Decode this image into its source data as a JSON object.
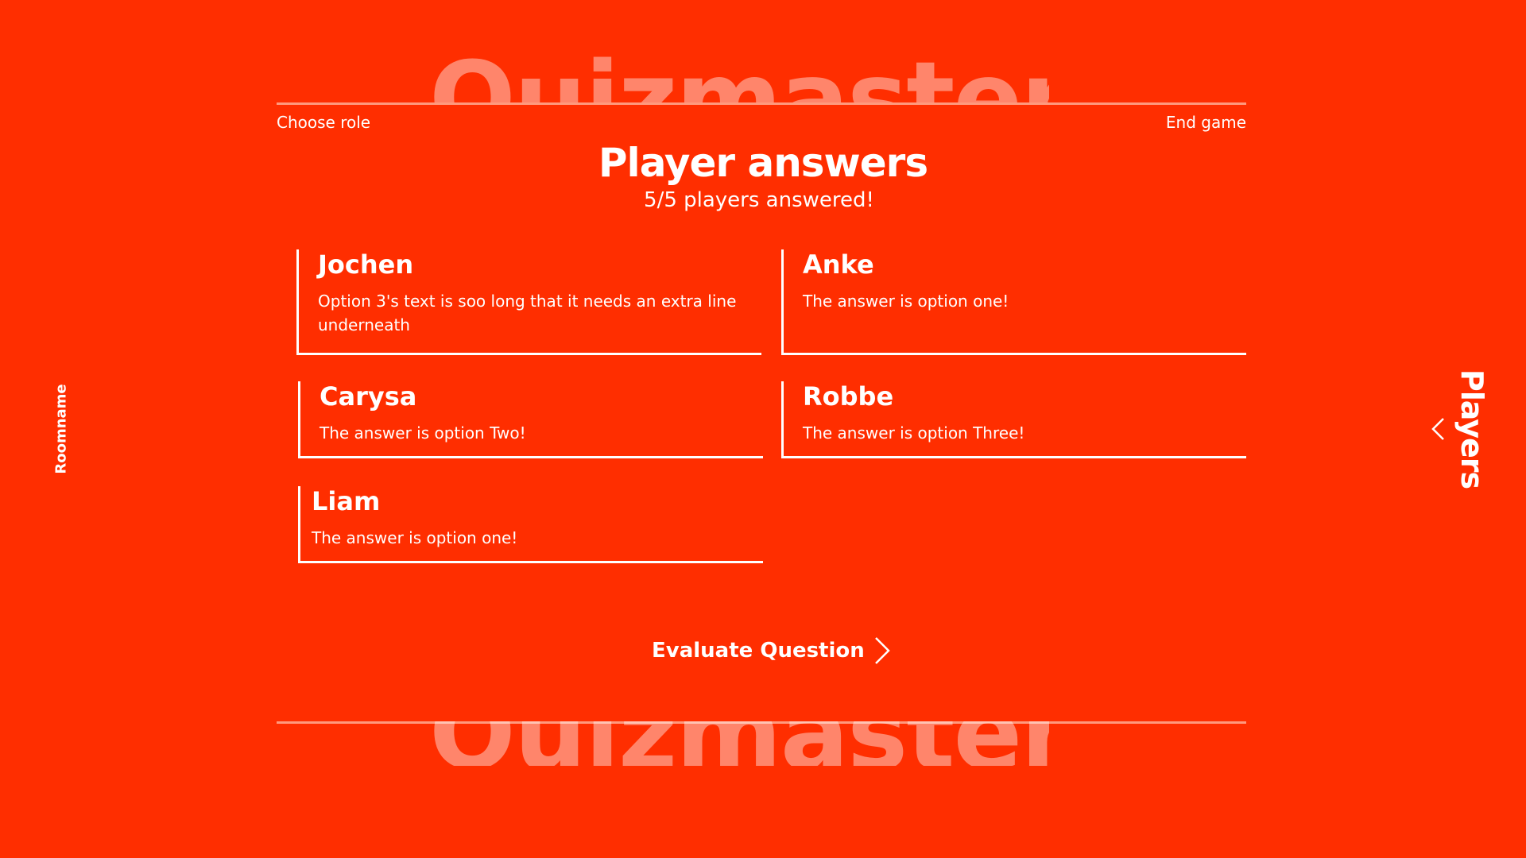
{
  "brand": {
    "watermark_text": "Quizmaster"
  },
  "nav": {
    "choose_role": "Choose role",
    "end_game": "End game"
  },
  "header": {
    "title": "Player answers",
    "subtitle": "5/5 players answered!"
  },
  "answers": [
    {
      "name": "Jochen",
      "answer": "Option 3's text is soo long that it needs an extra line underneath"
    },
    {
      "name": "Anke",
      "answer": "The answer is option one!"
    },
    {
      "name": "Carysa",
      "answer": "The answer is option Two!"
    },
    {
      "name": "Robbe",
      "answer": "The answer is option Three!"
    },
    {
      "name": "Liam",
      "answer": "The answer is option one!"
    }
  ],
  "actions": {
    "evaluate_label": "Evaluate Question"
  },
  "sidebar": {
    "room_name": "Roomname",
    "players_label": "Players"
  },
  "icons": {
    "next": "chevron-right-icon",
    "open_players": "chevron-left-icon"
  },
  "colors": {
    "background": "#ff2e00",
    "text": "#ffffff",
    "watermark": "#ff9a7e"
  }
}
